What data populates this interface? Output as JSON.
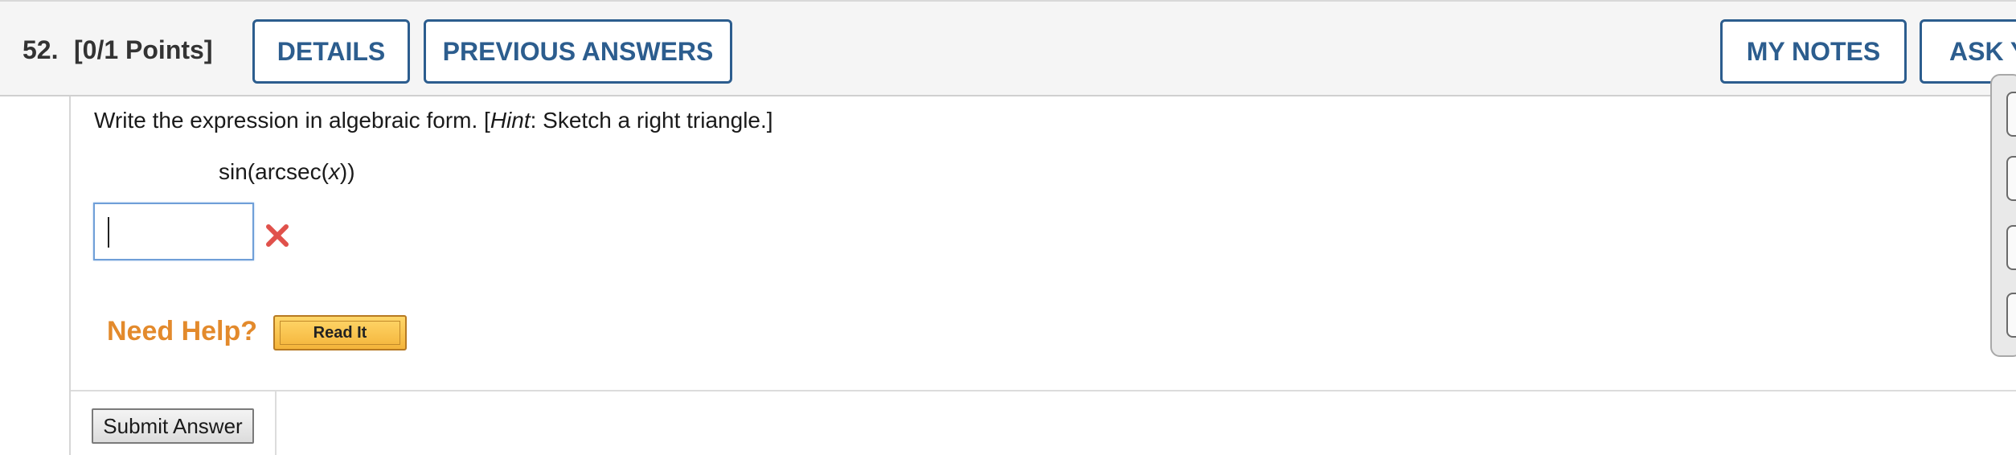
{
  "header": {
    "question_number": "52.",
    "points": "[0/1 Points]",
    "details_label": "DETAILS",
    "previous_answers_label": "PREVIOUS ANSWERS",
    "my_notes_label": "MY NOTES",
    "ask_label": "ASK Y"
  },
  "question": {
    "prompt_before": "Write the expression in algebraic form. [",
    "prompt_hint": "Hint",
    "prompt_after": ": Sketch a right triangle.]",
    "expr_prefix": "sin(arcsec(",
    "expr_var": "x",
    "expr_suffix": "))"
  },
  "answer": {
    "value": "",
    "status_icon": "x-mark-icon",
    "status_color": "#e0514b"
  },
  "help": {
    "need_help_label": "Need Help?",
    "read_it_label": "Read It"
  },
  "submit": {
    "label": "Submit Answer"
  },
  "colors": {
    "accent": "#2c5d8e",
    "need_help": "#e38a2c"
  }
}
